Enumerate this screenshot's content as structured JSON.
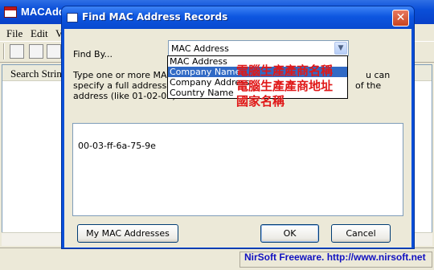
{
  "app": {
    "title": "MACAdd",
    "menu": [
      "File",
      "Edit",
      "V"
    ],
    "list_column": "Search String",
    "status": "NirSoft Freeware.  http://www.nirsoft.net"
  },
  "dialog": {
    "title": "Find MAC Address Records",
    "close_glyph": "✕",
    "find_by_label": "Find By...",
    "find_by_value": "MAC Address",
    "description": {
      "line1_a": "Type one or more MAC a",
      "line1_b": "u can",
      "line2_a": "specify a full address (lik",
      "line2_b": "of the",
      "line3": "address (like 01-02-03)"
    },
    "mac_value": "00-03-ff-6a-75-9e",
    "buttons": {
      "my_mac": "My MAC Addresses",
      "ok": "OK",
      "cancel": "Cancel"
    },
    "dropdown_options": [
      {
        "label": "MAC Address",
        "selected": false
      },
      {
        "label": "Company Name",
        "selected": true
      },
      {
        "label": "Company Address",
        "selected": false
      },
      {
        "label": "Country Name",
        "selected": false
      }
    ]
  },
  "annotations": [
    "電腦生產產商名稱",
    "電腦生產產商地址",
    "國家名稱"
  ],
  "colors": {
    "title_blue": "#0a4fd8",
    "selection": "#316ac5",
    "annotation_red": "#e01818",
    "status_link": "#1010c0"
  }
}
